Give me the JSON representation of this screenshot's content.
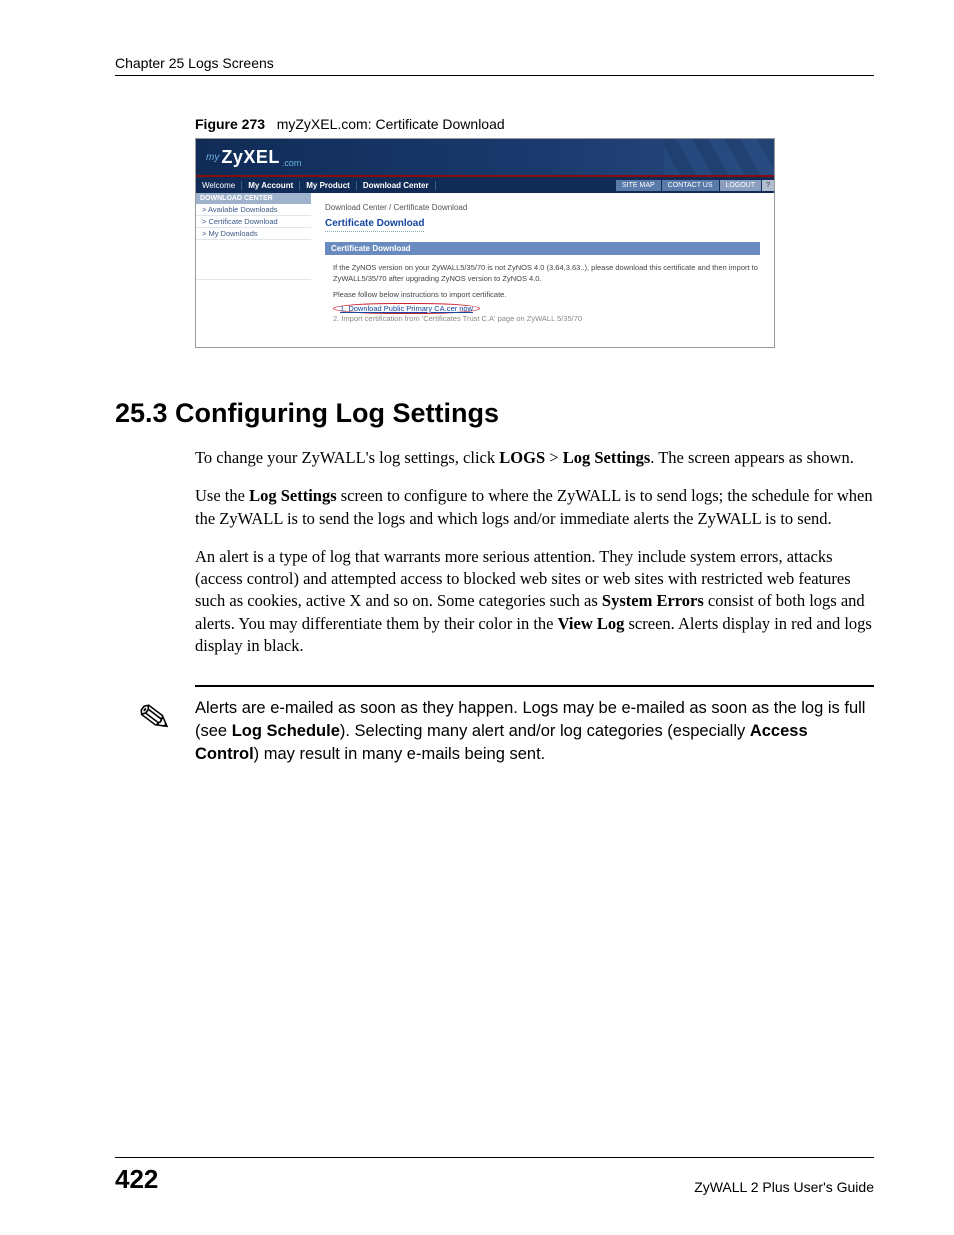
{
  "header": {
    "running": "Chapter 25 Logs Screens"
  },
  "figure": {
    "label": "Figure 273",
    "caption": "myZyXEL.com: Certificate Download",
    "logo": {
      "my": "my",
      "zyxel": "ZyXEL",
      "com": ".com"
    },
    "nav": {
      "welcome": "Welcome",
      "my_account": "My Account",
      "my_product": "My Product",
      "download_center": "Download Center",
      "site_map": "SITE MAP",
      "contact_us": "CONTACT US",
      "logout": "LOGOUT",
      "help": "?"
    },
    "sidebar": {
      "head": "DOWNLOAD CENTER",
      "items": [
        "> Available Downloads",
        "> Certificate Download",
        "> My Downloads"
      ]
    },
    "main": {
      "crumb": "Download Center / Certificate Download",
      "title": "Certificate Download",
      "bar": "Certificate Download",
      "para1": "If the ZyNOS version on your ZyWALL5/35/70 is not ZyNOS 4.0 (3.64,3.63..), please download this certificate and then import to ZyWALL5/35/70 after upgrading ZyNOS version to ZyNOS 4.0.",
      "para2": "Please follow below instructions to import certificate.",
      "step1": "1. Download Public Primary CA.cer now",
      "step2": "2. Import certification from 'Certificates Trust C.A' page on ZyWALL 5/35/70"
    }
  },
  "section": {
    "heading": "25.3  Configuring Log Settings",
    "p1a": "To change your ZyWALL's log settings, click ",
    "p1b": "LOGS",
    "p1c": " > ",
    "p1d": "Log Settings",
    "p1e": ". The screen appears as shown.",
    "p2a": "Use the ",
    "p2b": "Log Settings",
    "p2c": " screen to configure to where the ZyWALL is to send logs; the schedule for when the ZyWALL is to send the logs and which logs and/or immediate alerts the ZyWALL is to send.",
    "p3a": "An alert is a type of log that warrants more serious attention. They include system errors, attacks (access control) and attempted access to blocked web sites or web sites with restricted web features such as cookies, active X and so on. Some categories such as ",
    "p3b": "System Errors",
    "p3c": " consist of both logs and alerts. You may differentiate them by their color in the ",
    "p3d": "View Log",
    "p3e": " screen. Alerts display in red and logs display in black."
  },
  "note": {
    "icon": "✎",
    "t1": "Alerts are e-mailed as soon as they happen. Logs may be e-mailed as soon as the log is full (see ",
    "t2": "Log Schedule",
    "t3": "). Selecting many alert and/or log categories (especially ",
    "t4": "Access Control",
    "t5": ") may result in many e-mails being sent."
  },
  "footer": {
    "page": "422",
    "guide": "ZyWALL 2 Plus User's Guide"
  }
}
